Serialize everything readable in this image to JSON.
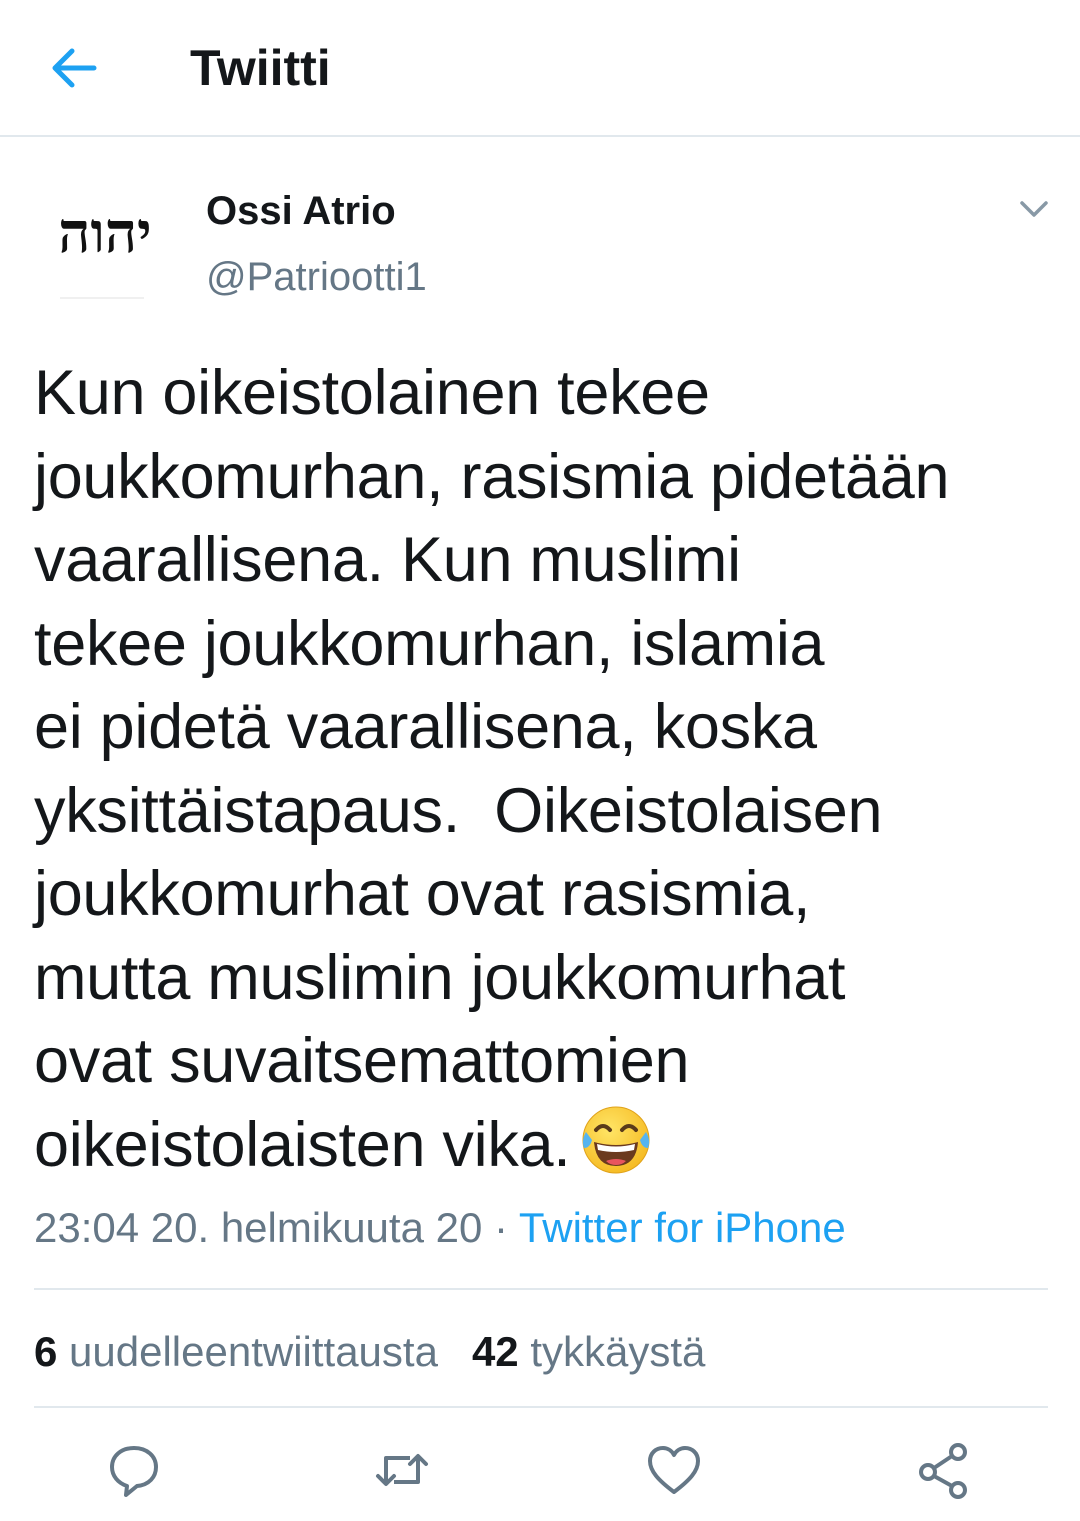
{
  "header": {
    "back_icon": "arrow-left-icon",
    "title": "Twiitti"
  },
  "author": {
    "avatar_text": "יהוה",
    "name": "Ossi Atrio",
    "handle": "@Patriootti1",
    "menu_icon": "chevron-down-icon"
  },
  "tweet": {
    "lines": [
      "Kun oikeistolainen tekee",
      "joukkomurhan, rasismia pidetään",
      "vaarallisena. Kun muslimi",
      "tekee joukkomurhan, islamia",
      "ei pidetä vaarallisena, koska",
      "yksittäistapaus.  Oikeistolaisen",
      "joukkomurhat ovat rasismia,",
      "mutta muslimin joukkomurhat",
      "ovat suvaitsemattomien",
      "oikeistolaisten vika."
    ],
    "emoji": "face-with-tears-of-joy-emoji"
  },
  "meta": {
    "timestamp": "23:04 20. helmikuuta 20",
    "separator": "·",
    "source": "Twitter for iPhone"
  },
  "stats": {
    "retweets_count": "6",
    "retweets_label": "uudelleentwiittausta",
    "likes_count": "42",
    "likes_label": "tykkäystä"
  },
  "actions": {
    "reply_icon": "reply-icon",
    "retweet_icon": "retweet-icon",
    "like_icon": "heart-icon",
    "share_icon": "share-icon"
  },
  "colors": {
    "accent": "#1da1f2",
    "text": "#14171a",
    "secondary": "#657786",
    "divider": "#e1e8ed"
  }
}
